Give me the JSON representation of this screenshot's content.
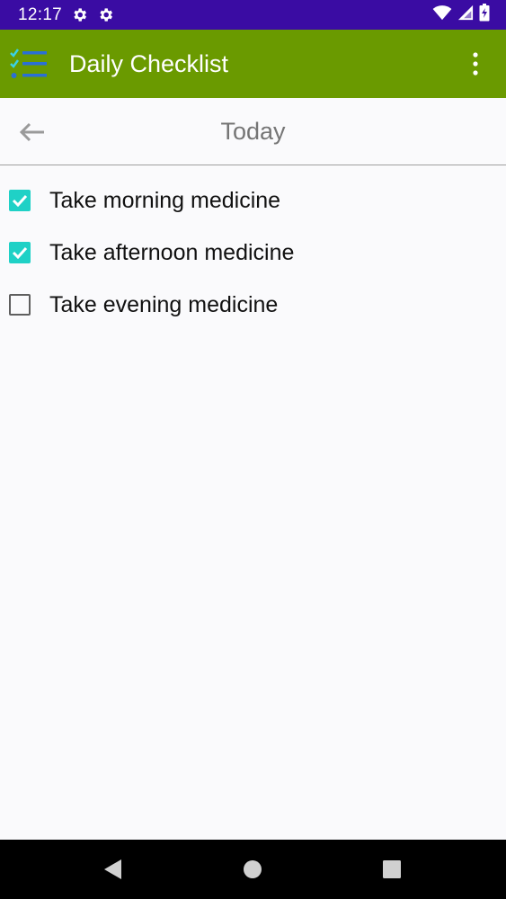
{
  "status_bar": {
    "time": "12:17",
    "icons": [
      "gear-icon",
      "gear-icon",
      "wifi-icon",
      "signal-icon",
      "battery-icon"
    ]
  },
  "app_bar": {
    "title": "Daily Checklist",
    "logo_icon": "checklist-icon",
    "menu_icon": "more-vert-icon",
    "background": "#6a9a00"
  },
  "date_header": {
    "title": "Today",
    "back_icon": "arrow-left-icon"
  },
  "checklist": {
    "items": [
      {
        "label": "Take morning medicine",
        "checked": true
      },
      {
        "label": "Take afternoon medicine",
        "checked": true
      },
      {
        "label": "Take evening medicine",
        "checked": false
      }
    ],
    "accent": "#1fd1c6"
  },
  "nav_bar": {
    "icons": [
      "back-triangle-icon",
      "home-circle-icon",
      "recents-square-icon"
    ]
  }
}
